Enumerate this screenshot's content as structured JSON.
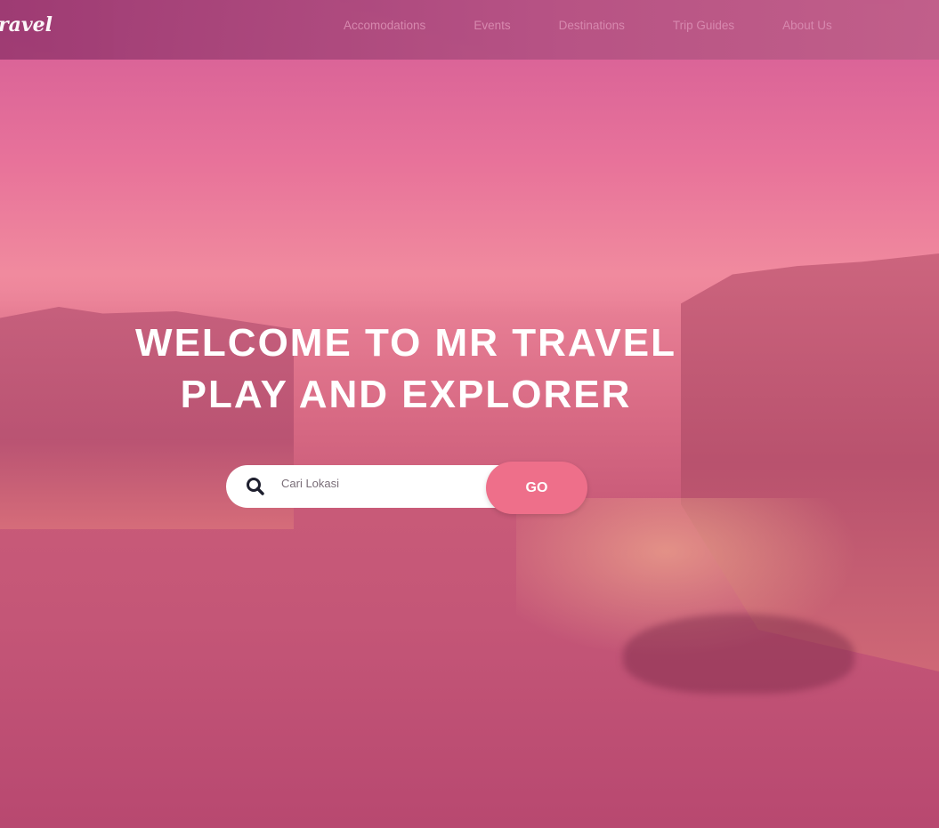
{
  "logo": "ravel",
  "nav": [
    "Accomodations",
    "Events",
    "Destinations",
    "Trip Guides",
    "About Us"
  ],
  "hero": {
    "line1": "WELCOME TO MR TRAVEL",
    "line2": "PLAY AND EXPLORER"
  },
  "search": {
    "placeholder": "Cari Lokasi",
    "button": "GO"
  }
}
